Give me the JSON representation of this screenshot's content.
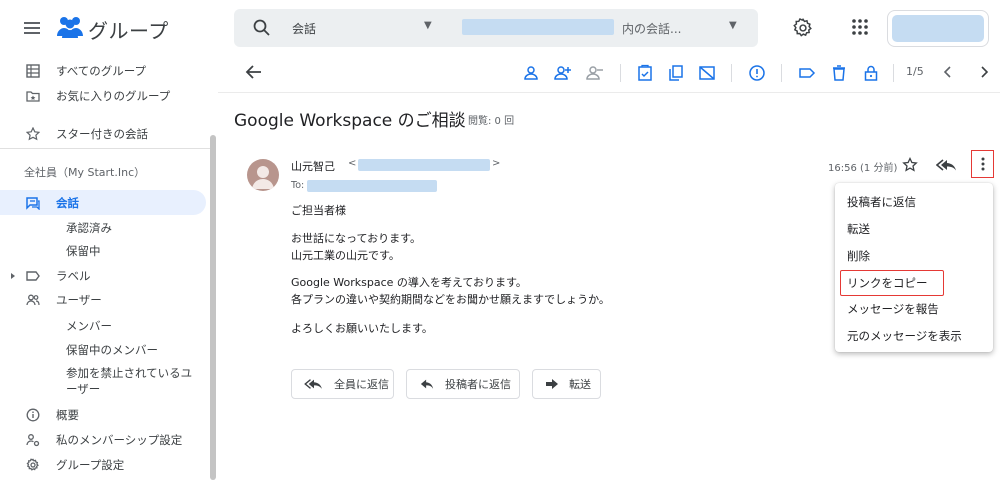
{
  "app": {
    "title": "グループ"
  },
  "search": {
    "scope": "会話",
    "group_suffix": "内の会話..."
  },
  "sidebar": {
    "items_top": [
      {
        "label": "すべてのグループ",
        "icon": "grid-icon"
      },
      {
        "label": "お気に入りのグループ",
        "icon": "folder-star-icon"
      }
    ],
    "starred": {
      "label": "スター付きの会話",
      "icon": "star-icon"
    },
    "section_header": "全社員（My Start.Inc）",
    "conversations": {
      "label": "会話"
    },
    "approved": {
      "label": "承認済み"
    },
    "pending": {
      "label": "保留中"
    },
    "labels": {
      "label": "ラベル"
    },
    "users": {
      "label": "ユーザー"
    },
    "members": {
      "label": "メンバー"
    },
    "pending_members": {
      "label": "保留中のメンバー"
    },
    "banned_line1": "参加を禁止されているユ",
    "banned_line2": "ーザー",
    "overview": {
      "label": "概要"
    },
    "membership": {
      "label": "私のメンバーシップ設定"
    },
    "group_settings": {
      "label": "グループ設定"
    }
  },
  "toolbar": {
    "pagination": "1/5"
  },
  "thread": {
    "subject": "Google Workspace のご相談",
    "views": "閲覧: 0 回"
  },
  "message": {
    "sender_name": "山元智己",
    "email_open": "<",
    "email_close": ">",
    "to_label": "To:",
    "time": "16:56 (1 分前)",
    "body": [
      "ご担当者様",
      "お世話になっております。",
      "山元工業の山元です。",
      "Google Workspace の導入を考えております。",
      "各プランの違いや契約期間などをお聞かせ願えますでしょうか。",
      "よろしくお願いいたします。"
    ]
  },
  "actions": {
    "reply_all": "全員に返信",
    "reply_author": "投稿者に返信",
    "forward": "転送"
  },
  "more_menu": {
    "items": [
      "投稿者に返信",
      "転送",
      "削除",
      "リンクをコピー",
      "メッセージを報告",
      "元のメッセージを表示"
    ]
  },
  "colors": {
    "accent": "#1a73e8",
    "highlight": "#e53935",
    "redacted": "#c5dcf2"
  }
}
